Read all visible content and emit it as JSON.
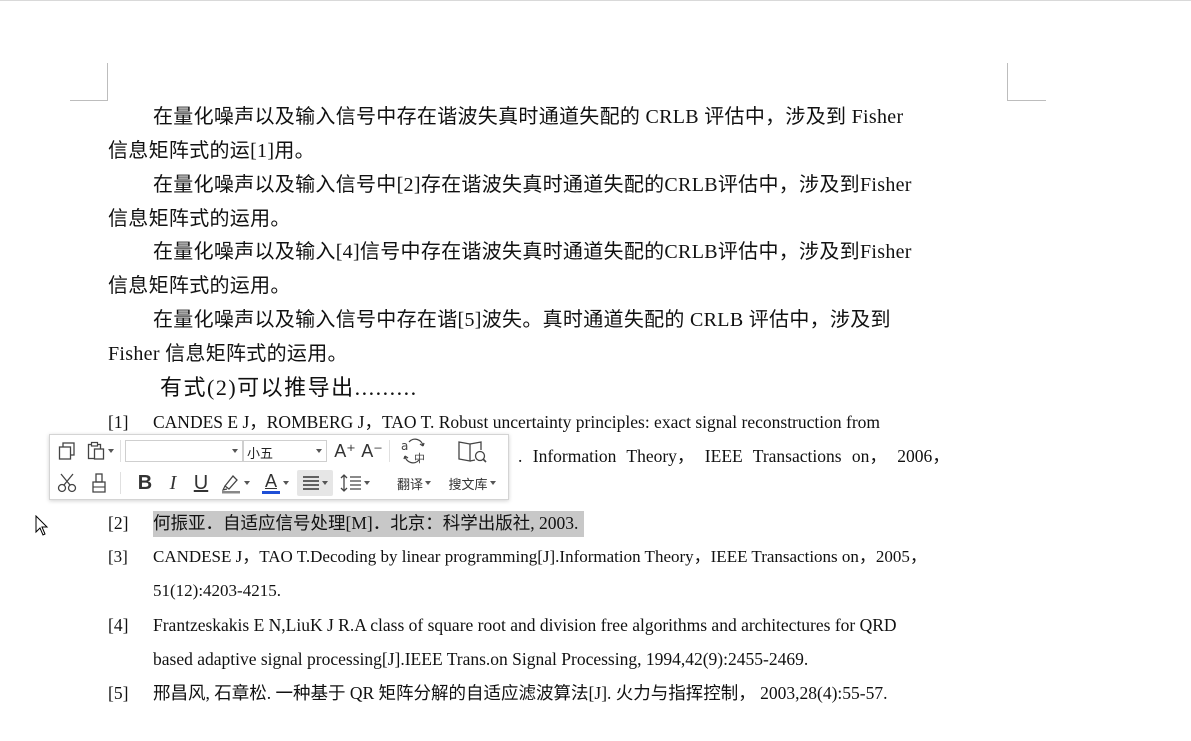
{
  "paragraphs": [
    {
      "line1": "在量化噪声以及输入信号中存在谐波失真时通道失配的 CRLB 评估中，涉及到 Fisher",
      "line2": "信息矩阵式的运[1]用。"
    },
    {
      "line1": "在量化噪声以及输入信号中[2]存在谐波失真时通道失配的CRLB评估中，涉及到Fisher",
      "line2": "信息矩阵式的运用。"
    },
    {
      "line1": "在量化噪声以及输入[4]信号中存在谐波失真时通道失配的CRLB评估中，涉及到Fisher",
      "line2": "信息矩阵式的运用。"
    },
    {
      "line1": "在量化噪声以及输入信号中存在谐[5]波失。真时通道失配的 CRLB 评估中，涉及到",
      "line2": "Fisher 信息矩阵式的运用。"
    }
  ],
  "derivation_line": "有式(2)可以推导出.........",
  "references": [
    {
      "num": "[1]",
      "line1": "CANDES E J，ROMBERG J，TAO T. Robust uncertainty principles: exact signal reconstruction from",
      "line2": ". Information  Theory，  IEEE  Transactions  on，  2006，"
    },
    {
      "num": "[2]",
      "line1": "何振亚．自适应信号处理[M]．北京：科学出版社, 2003.",
      "line2": ""
    },
    {
      "num": "[3]",
      "line1": "CANDESE J，TAO T.Decoding by linear programming[J].Information Theory，IEEE Transactions on，2005，",
      "line2": "51(12):4203-4215."
    },
    {
      "num": "[4]",
      "line1": "Frantzeskakis E N,LiuK J R.A class of square root and division free algorithms and architectures for QRD",
      "line2": "based adaptive signal processing[J].IEEE Trans.on Signal Processing, 1994,42(9):2455-2469."
    },
    {
      "num": "[5]",
      "line1": "邢昌风, 石章松. 一种基于 QR 矩阵分解的自适应滤波算法[J]. 火力与指挥控制， 2003,28(4):55-57.",
      "line2": ""
    }
  ],
  "toolbar": {
    "font_name": "",
    "font_size": "小五",
    "grow_font": "A⁺",
    "shrink_font": "A⁻",
    "bold": "B",
    "italic": "I",
    "underline": "U",
    "font_color_letter": "A",
    "translate_label": "翻译",
    "search_lib_label": "搜文库"
  },
  "colors": {
    "selection": "#c8c8c8",
    "font_color_bar": "#1f4fd6",
    "highlight_bar": "#888888"
  }
}
